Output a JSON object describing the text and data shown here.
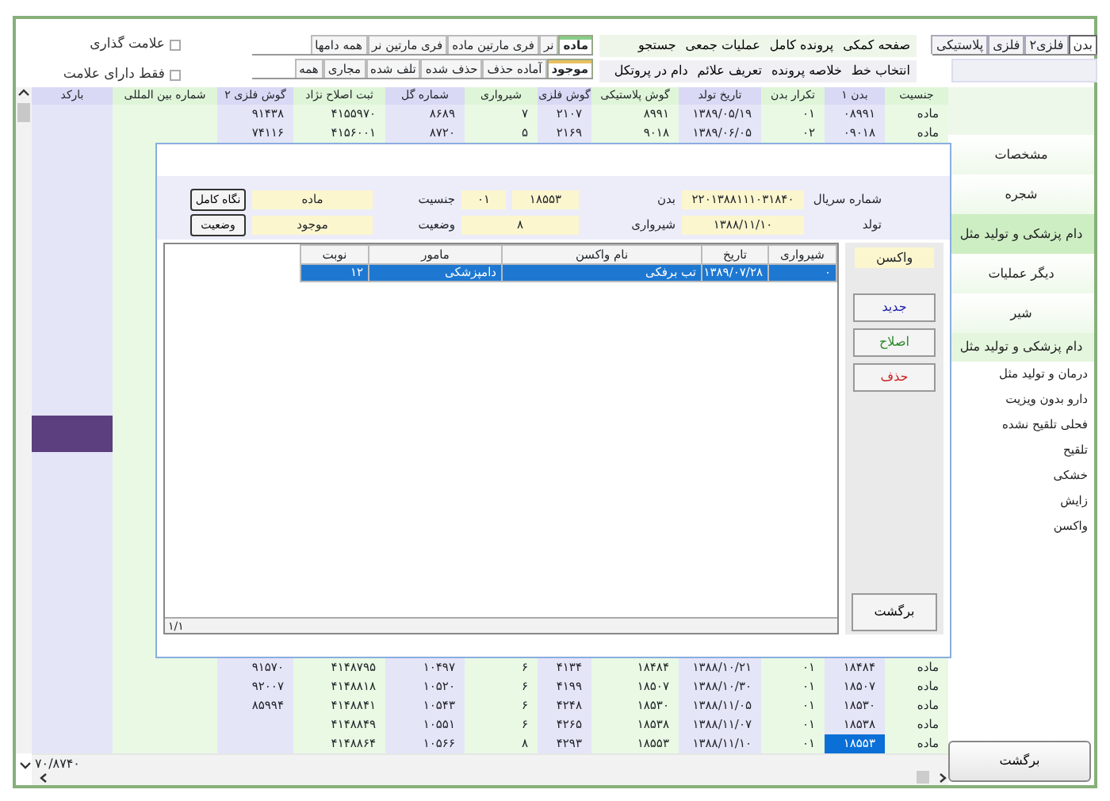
{
  "top_tabs": [
    {
      "label": "بدن",
      "selected": true
    },
    {
      "label": "فلزی۲",
      "selected": false
    },
    {
      "label": "فلزی",
      "selected": false
    },
    {
      "label": "پلاستیکی",
      "selected": false
    }
  ],
  "menu": [
    [
      "صفحه کمکی",
      "پرونده کامل",
      "عملیات جمعی",
      "جستجو"
    ],
    [
      "انتخاب خط",
      "خلاصه پرونده",
      "تعریف علائم",
      "دام در پروتکل"
    ]
  ],
  "sex_filter": [
    {
      "label": "ماده",
      "selected": true
    },
    {
      "label": "نر",
      "selected": false
    },
    {
      "label": "فری مارتین ماده",
      "selected": false
    },
    {
      "label": "فری مارتین نر",
      "selected": false
    },
    {
      "label": "همه دامها",
      "selected": false
    }
  ],
  "status_filter": [
    {
      "label": "موجود",
      "selected": true
    },
    {
      "label": "آماده حذف",
      "selected": false
    },
    {
      "label": "حذف شده",
      "selected": false
    },
    {
      "label": "تلف شده",
      "selected": false
    },
    {
      "label": "مجاری",
      "selected": false
    },
    {
      "label": "همه",
      "selected": false
    }
  ],
  "checkboxes": [
    {
      "label": "علامت گذاری",
      "checked": false
    },
    {
      "label": "فقط دارای علامت",
      "checked": false
    }
  ],
  "table": {
    "columns": [
      "جنسیت",
      "بدن ۱",
      "تکرار بدن",
      "تاریخ تولد",
      "گوش پلاستیکی",
      "گوش فلزی",
      "شیرواری",
      "شماره گل",
      "ثبت اصلاح نژاد",
      "گوش فلزی ۲",
      "شماره بین المللی",
      "بارکد"
    ],
    "rows_top": [
      {
        "cells": [
          "ماده",
          "۰۸۹۹۱",
          "۰۱",
          "۱۳۸۹/۰۵/۱۹",
          "۸۹۹۱",
          "۲۱۰۷",
          "۷",
          "۸۶۸۹",
          "۴۱۵۵۹۷۰",
          "۹۱۴۳۸",
          "",
          ""
        ],
        "selected": false
      },
      {
        "cells": [
          "ماده",
          "۰۹۰۱۸",
          "۰۲",
          "۱۳۸۹/۰۶/۰۵",
          "۹۰۱۸",
          "۲۱۶۹",
          "۵",
          "۸۷۲۰",
          "۴۱۵۶۰۰۱",
          "۷۴۱۱۶",
          "",
          ""
        ],
        "selected": false
      }
    ],
    "rows_bottom": [
      {
        "cells": [
          "ماده",
          "۱۸۴۸۴",
          "۰۱",
          "۱۳۸۸/۱۰/۲۱",
          "۱۸۴۸۴",
          "۴۱۳۴",
          "۶",
          "۱۰۴۹۷",
          "۴۱۴۸۷۹۵",
          "۹۱۵۷۰",
          "",
          ""
        ],
        "selected": false
      },
      {
        "cells": [
          "ماده",
          "۱۸۵۰۷",
          "۰۱",
          "۱۳۸۸/۱۰/۳۰",
          "۱۸۵۰۷",
          "۴۱۹۹",
          "۶",
          "۱۰۵۲۰",
          "۴۱۴۸۸۱۸",
          "۹۲۰۰۷",
          "",
          ""
        ],
        "selected": false
      },
      {
        "cells": [
          "ماده",
          "۱۸۵۳۰",
          "۰۱",
          "۱۳۸۸/۱۱/۰۵",
          "۱۸۵۳۰",
          "۴۲۴۸",
          "۶",
          "۱۰۵۴۳",
          "۴۱۴۸۸۴۱",
          "۸۵۹۹۴",
          "",
          ""
        ],
        "selected": false
      },
      {
        "cells": [
          "ماده",
          "۱۸۵۳۸",
          "۰۱",
          "۱۳۸۸/۱۱/۰۷",
          "۱۸۵۳۸",
          "۴۲۶۵",
          "۶",
          "۱۰۵۵۱",
          "۴۱۴۸۸۴۹",
          "",
          "",
          ""
        ],
        "selected": false
      },
      {
        "cells": [
          "ماده",
          "۱۸۵۵۳",
          "۰۱",
          "۱۳۸۸/۱۱/۱۰",
          "۱۸۵۵۳",
          "۴۲۹۳",
          "۸",
          "۱۰۵۶۶",
          "۴۱۴۸۸۶۴",
          "",
          "",
          ""
        ],
        "selected": true
      }
    ]
  },
  "counter": "۷۰/۸۷۴۰",
  "sidebar": [
    {
      "label": "مشخصات",
      "kind": "item",
      "selected": false
    },
    {
      "label": "شجره",
      "kind": "item",
      "selected": false
    },
    {
      "label": "دام پزشکی و تولید مثل",
      "kind": "item",
      "selected": true
    },
    {
      "label": "دیگر عملیات",
      "kind": "item",
      "selected": false
    },
    {
      "label": "شیر",
      "kind": "item",
      "selected": false
    },
    {
      "label": "دام پزشکی و تولید مثل",
      "kind": "header",
      "selected": false
    },
    {
      "label": "درمان و تولید مثل",
      "kind": "subitem",
      "selected": false
    },
    {
      "label": "دارو بدون ویزیت",
      "kind": "subitem",
      "selected": false
    },
    {
      "label": "فحلی تلقیح نشده",
      "kind": "subitem",
      "selected": false
    },
    {
      "label": "تلقیح",
      "kind": "subitem",
      "selected": false
    },
    {
      "label": "خشکی",
      "kind": "subitem",
      "selected": false
    },
    {
      "label": "زایش",
      "kind": "subitem",
      "selected": false
    },
    {
      "label": "واکسن",
      "kind": "subitem",
      "selected": false
    }
  ],
  "back_button": "برگشت",
  "dialog": {
    "serial_label": "شماره سریال",
    "serial": "۲۲۰۱۳۸۸۱۱۱۰۳۱۸۴۰",
    "body_label": "بدن",
    "body": "۱۸۵۵۳",
    "body_repeat": "۰۱",
    "sex_label": "جنسیت",
    "sex": "ماده",
    "birth_label": "تولد",
    "birth": "۱۳۸۸/۱۱/۱۰",
    "lactation_label": "شیرواری",
    "lactation": "۸",
    "status_label": "وضعیت",
    "status": "موجود",
    "buttons": [
      "نگاه کامل",
      "وضعیت"
    ],
    "grid": {
      "columns": [
        "شیرواری",
        "تاریخ",
        "نام واکسن",
        "مامور",
        "نوبت"
      ],
      "rows": [
        {
          "cells": [
            "۰",
            "۱۳۸۹/۰۷/۲۸",
            "تب برفکی",
            "دامپزشکی",
            "۱۲"
          ],
          "selected": true
        }
      ]
    },
    "pager": "۱/۱",
    "panel_title": "واکسن",
    "actions": [
      {
        "label": "جدید",
        "color": "#2222aa"
      },
      {
        "label": "اصلاح",
        "color": "#2a8a2a"
      },
      {
        "label": "حذف",
        "color": "#cc2222"
      }
    ],
    "back": "برگشت"
  }
}
